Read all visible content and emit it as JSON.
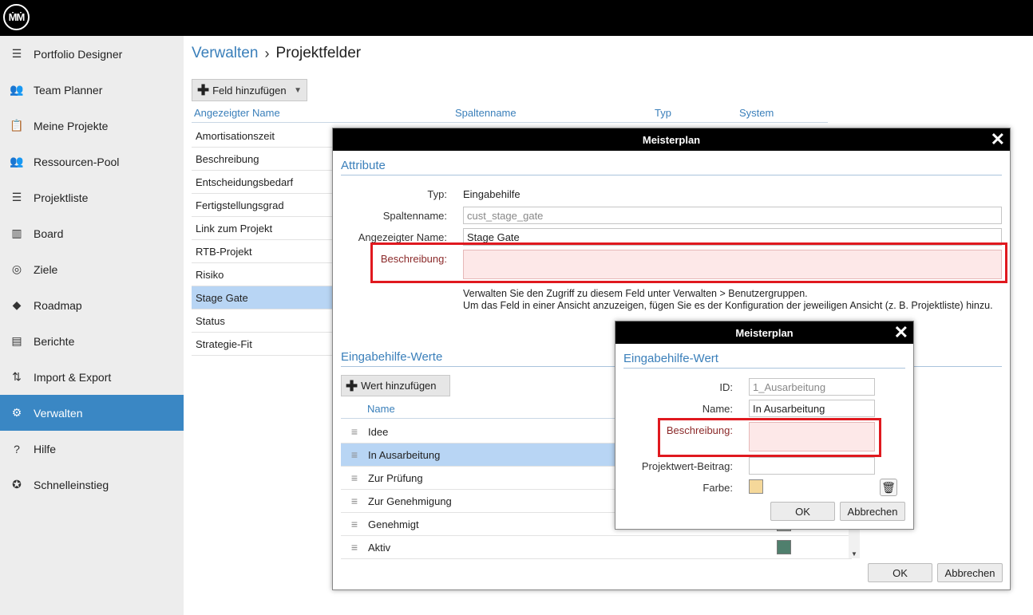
{
  "topbar": {
    "logo_text": "ṀṀ"
  },
  "sidebar": {
    "items": [
      {
        "label": "Portfolio Designer",
        "icon": "portfolio-designer-icon",
        "glyph": "☰"
      },
      {
        "label": "Team Planner",
        "icon": "team-planner-icon",
        "glyph": "👥"
      },
      {
        "label": "Meine Projekte",
        "icon": "clipboard-icon",
        "glyph": "📋"
      },
      {
        "label": "Ressourcen-Pool",
        "icon": "people-icon",
        "glyph": "👥"
      },
      {
        "label": "Projektliste",
        "icon": "list-icon",
        "glyph": "☰"
      },
      {
        "label": "Board",
        "icon": "board-icon",
        "glyph": "▥"
      },
      {
        "label": "Ziele",
        "icon": "target-icon",
        "glyph": "◎"
      },
      {
        "label": "Roadmap",
        "icon": "roadmap-icon",
        "glyph": "◆"
      },
      {
        "label": "Berichte",
        "icon": "report-icon",
        "glyph": "▤"
      },
      {
        "label": "Import & Export",
        "icon": "import-export-icon",
        "glyph": "⇅"
      },
      {
        "label": "Verwalten",
        "icon": "gear-icon",
        "glyph": "⚙"
      },
      {
        "label": "Hilfe",
        "icon": "help-icon",
        "glyph": "?"
      },
      {
        "label": "Schnelleinstieg",
        "icon": "compass-icon",
        "glyph": "✪"
      }
    ],
    "active_index": 10
  },
  "breadcrumb": {
    "parent": "Verwalten",
    "separator": "›",
    "current": "Projektfelder"
  },
  "toolbar": {
    "add_field_label": "Feld hinzufügen"
  },
  "table": {
    "columns": [
      "Angezeigter Name",
      "Spaltenname",
      "Typ",
      "System"
    ],
    "rows": [
      "Amortisationszeit",
      "Beschreibung",
      "Entscheidungsbedarf",
      "Fertigstellungsgrad",
      "Link zum Projekt",
      "RTB-Projekt",
      "Risiko",
      "Stage Gate",
      "Status",
      "Strategie-Fit"
    ],
    "selected": "Stage Gate"
  },
  "dialog_main": {
    "title": "Meisterplan",
    "section_attributes": "Attribute",
    "typ_label": "Typ:",
    "typ_value": "Eingabehilfe",
    "spaltenname_label": "Spaltenname:",
    "spaltenname_value": "cust_stage_gate",
    "name_label": "Angezeigter Name:",
    "name_value": "Stage Gate",
    "beschreibung_label": "Beschreibung:",
    "beschreibung_value": "",
    "help_line1": "Verwalten Sie den Zugriff zu diesem Feld unter Verwalten > Benutzergruppen.",
    "help_line2": "Um das Feld in einer Ansicht anzuzeigen, fügen Sie es der Konfiguration der jeweiligen Ansicht (z. B. Projektliste) hinzu.",
    "section_values": "Eingabehilfe-Werte",
    "add_value_label": "Wert hinzufügen",
    "values_column": "Name",
    "values": [
      {
        "name": "Idee",
        "color": ""
      },
      {
        "name": "In Ausarbeitung",
        "color": ""
      },
      {
        "name": "Zur Prüfung",
        "color": ""
      },
      {
        "name": "Zur Genehmigung",
        "color": ""
      },
      {
        "name": "Genehmigt",
        "color": "#a0a8a4"
      },
      {
        "name": "Aktiv",
        "color": "#4f7f6d"
      }
    ],
    "selected_value": "In Ausarbeitung",
    "ok_label": "OK",
    "cancel_label": "Abbrechen"
  },
  "dialog_value": {
    "title": "Meisterplan",
    "section_title": "Eingabehilfe-Wert",
    "id_label": "ID:",
    "id_value": "1_Ausarbeitung",
    "name_label": "Name:",
    "name_value": "In Ausarbeitung",
    "beschreibung_label": "Beschreibung:",
    "beschreibung_value": "",
    "beitrag_label": "Projektwert-Beitrag:",
    "beitrag_value": "",
    "farbe_label": "Farbe:",
    "farbe_color": "#f5d89a",
    "ok_label": "OK",
    "cancel_label": "Abbrechen"
  },
  "colors": {
    "accent": "#3a87c4",
    "link": "#3a7fba",
    "selection": "#b8d5f4",
    "highlight": "#e0191f"
  }
}
